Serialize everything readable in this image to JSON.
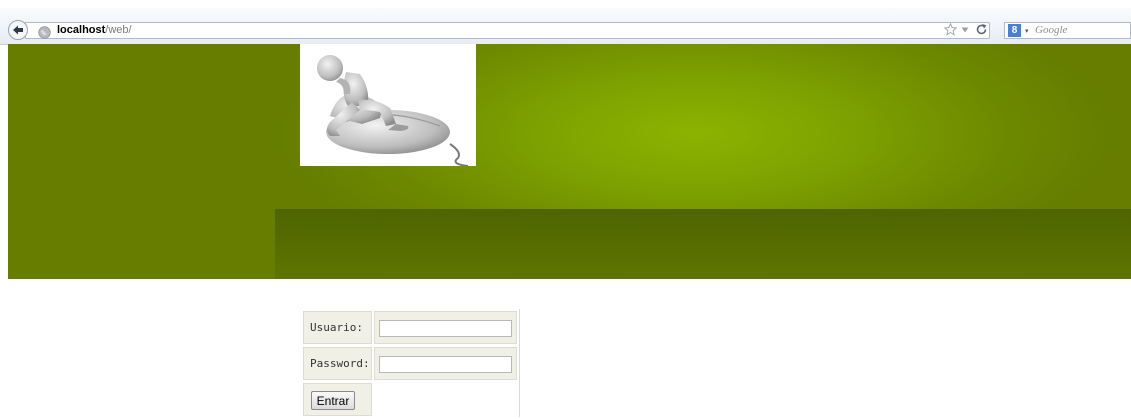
{
  "browser": {
    "url_host": "localhost",
    "url_path": "/web/",
    "search_placeholder": "Google",
    "search_engine_icon": "google-icon"
  },
  "colors": {
    "banner": "#667d00",
    "banner_highlight": "#8cb300",
    "banner_band": "#4f6400",
    "form_cell": "#f0f0e6"
  },
  "login": {
    "user_label": "Usuario:",
    "user_value": "",
    "password_label": "Password:",
    "password_value": "",
    "submit_label": "Entrar"
  }
}
